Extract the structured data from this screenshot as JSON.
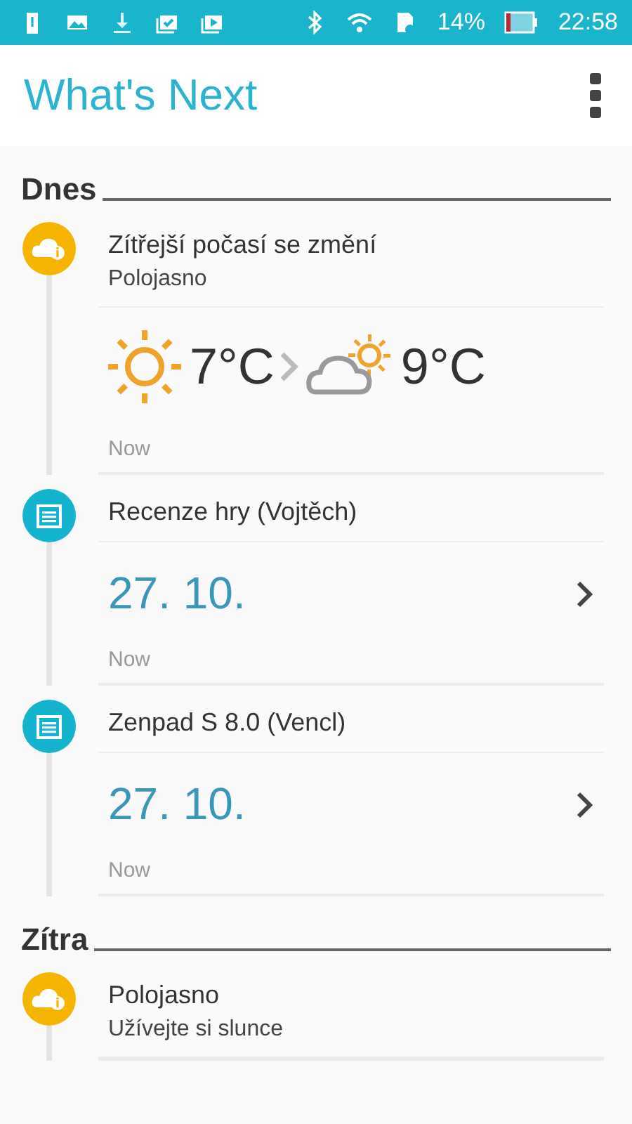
{
  "status_bar": {
    "battery": "14%",
    "time": "22:58"
  },
  "app_bar": {
    "title": "What's Next"
  },
  "sections": [
    {
      "heading": "Dnes",
      "cards": [
        {
          "kind": "weather",
          "title": "Zítřejší počasí se změní",
          "subtitle": "Polojasno",
          "from_temp": "7°C",
          "to_temp": "9°C",
          "time": "Now"
        },
        {
          "kind": "event",
          "title": "Recenze hry (Vojtěch)",
          "date": "27. 10.",
          "time": "Now"
        },
        {
          "kind": "event",
          "title": "Zenpad S 8.0 (Vencl)",
          "date": "27. 10.",
          "time": "Now"
        }
      ]
    },
    {
      "heading": "Zítra",
      "cards": [
        {
          "kind": "weather_brief",
          "title": "Polojasno",
          "subtitle": "Užívejte si slunce"
        }
      ]
    }
  ]
}
